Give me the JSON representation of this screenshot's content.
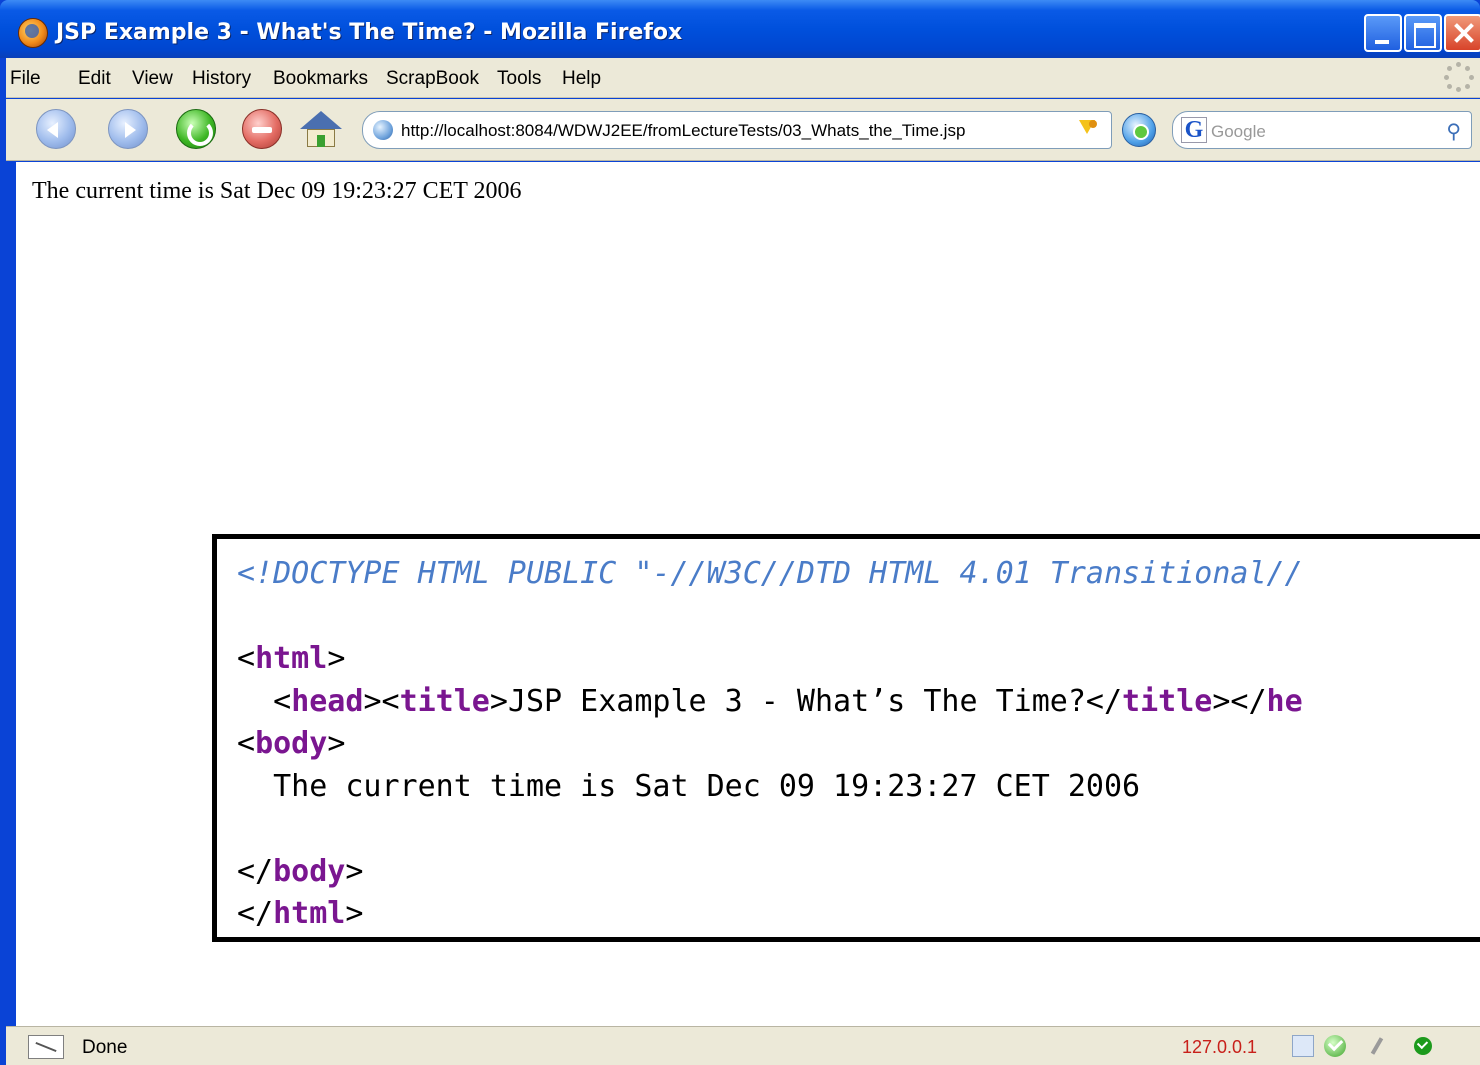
{
  "window": {
    "title": "JSP Example 3 - What's The Time? - Mozilla Firefox"
  },
  "menu": {
    "items": [
      "File",
      "Edit",
      "View",
      "History",
      "Bookmarks",
      "ScrapBook",
      "Tools",
      "Help"
    ]
  },
  "toolbar": {
    "url": "http://localhost:8084/WDWJ2EE/fromLectureTests/03_Whats_the_Time.jsp",
    "search_placeholder": "Google",
    "search_engine_letter": "G"
  },
  "page": {
    "text": "The current time is Sat Dec 09 19:23:27 CET 2006"
  },
  "source_view": {
    "doctype": "<!DOCTYPE HTML PUBLIC \"-//W3C//DTD HTML 4.01 Transitional//",
    "html_tag": "html",
    "head_tag": "head",
    "title_tag": "title",
    "title_text": "JSP Example 3 - What’s The Time?",
    "head_tail": "he",
    "body_tag": "body",
    "body_text": "The current time is Sat Dec 09 19:23:27 CET 2006"
  },
  "status": {
    "text": "Done",
    "ip": "127.0.0.1"
  }
}
